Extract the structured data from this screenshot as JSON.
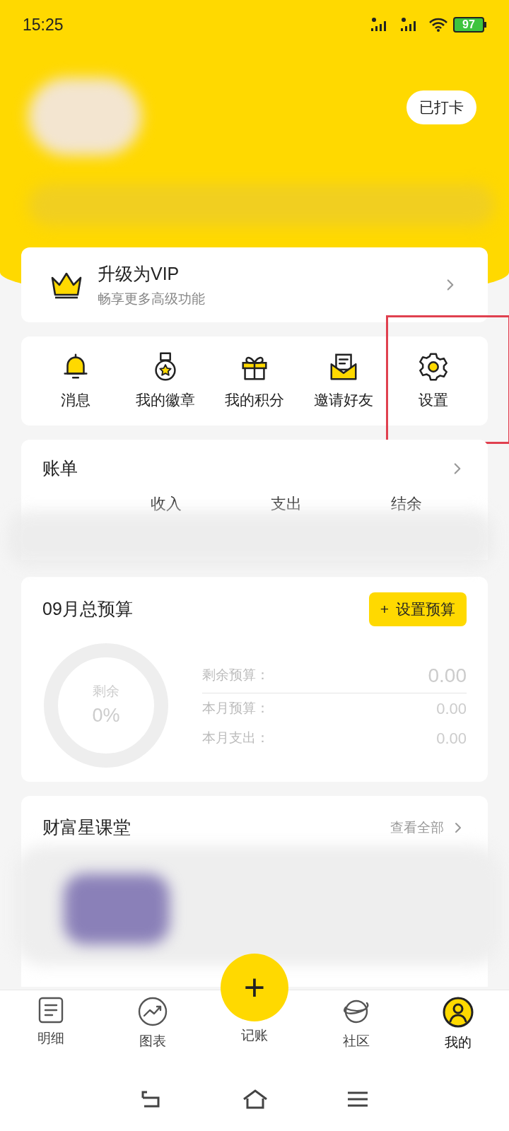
{
  "status_bar": {
    "time": "15:25",
    "battery": "97"
  },
  "header": {
    "checkin_button": "已打卡"
  },
  "vip_card": {
    "title": "升级为VIP",
    "subtitle": "畅享更多高级功能"
  },
  "shortcuts": [
    {
      "label": "消息",
      "kind": "bell",
      "highlighted": false
    },
    {
      "label": "我的徽章",
      "kind": "medal",
      "highlighted": false
    },
    {
      "label": "我的积分",
      "kind": "gift",
      "highlighted": false
    },
    {
      "label": "邀请好友",
      "kind": "mail",
      "highlighted": false
    },
    {
      "label": "设置",
      "kind": "gear",
      "highlighted": true
    }
  ],
  "bill": {
    "title": "账单",
    "columns": [
      "收入",
      "支出",
      "结余"
    ]
  },
  "budget": {
    "title": "09月总预算",
    "button_icon": "+",
    "button": "设置预算",
    "ring_label": "剩余",
    "percent": "0%",
    "rows": [
      {
        "label": "剩余预算：",
        "value": "0.00",
        "kind": "large"
      },
      {
        "label": "本月预算：",
        "value": "0.00",
        "kind": "small"
      },
      {
        "label": "本月支出：",
        "value": "0.00",
        "kind": "small"
      }
    ]
  },
  "course": {
    "title": "财富星课堂",
    "link": "查看全部"
  },
  "tabs": [
    {
      "label": "明细",
      "kind": "list",
      "selected": false
    },
    {
      "label": "图表",
      "kind": "chart",
      "selected": false
    },
    {
      "label": "记账",
      "kind": "add",
      "icon": "+",
      "selected": false
    },
    {
      "label": "社区",
      "kind": "planet",
      "selected": false
    },
    {
      "label": "我的",
      "kind": "user",
      "selected": true
    }
  ]
}
